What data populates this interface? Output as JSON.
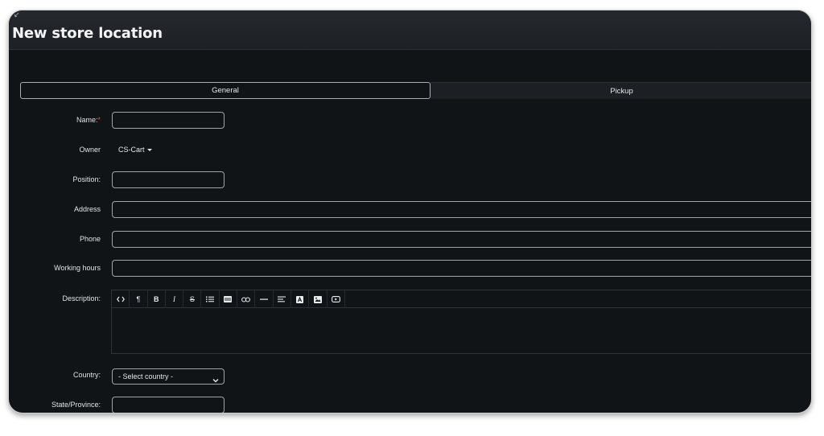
{
  "window": {
    "title": "New store location"
  },
  "tabs": [
    {
      "label": "General",
      "active": true
    },
    {
      "label": "Pickup",
      "active": false
    }
  ],
  "fields": {
    "name": {
      "label": "Name:",
      "required_mark": "*",
      "value": ""
    },
    "owner": {
      "label": "Owner",
      "value": "CS-Cart"
    },
    "position": {
      "label": "Position:",
      "value": ""
    },
    "address": {
      "label": "Address",
      "value": ""
    },
    "phone": {
      "label": "Phone",
      "value": ""
    },
    "working_hours": {
      "label": "Working hours",
      "value": ""
    },
    "description": {
      "label": "Description:",
      "value": ""
    },
    "country": {
      "label": "Country:",
      "selected": "- Select country -"
    },
    "state": {
      "label": "State/Province:",
      "value": ""
    }
  },
  "editor_toolbar": [
    {
      "icon": "code-view-icon"
    },
    {
      "icon": "paragraph-icon",
      "text": "¶"
    },
    {
      "icon": "bold-icon",
      "text": "B"
    },
    {
      "icon": "italic-icon",
      "text": "I"
    },
    {
      "icon": "strikethrough-icon",
      "text": "S"
    },
    {
      "icon": "unordered-list-icon"
    },
    {
      "icon": "ordered-list-icon"
    },
    {
      "icon": "link-icon"
    },
    {
      "icon": "horizontal-rule-icon"
    },
    {
      "icon": "align-icon"
    },
    {
      "icon": "image-text-icon"
    },
    {
      "icon": "image-icon"
    },
    {
      "icon": "video-icon"
    }
  ],
  "colors": {
    "background": "#111417",
    "header": "#25282c",
    "required": "#e04a4a",
    "border": "#9fa4a9"
  }
}
